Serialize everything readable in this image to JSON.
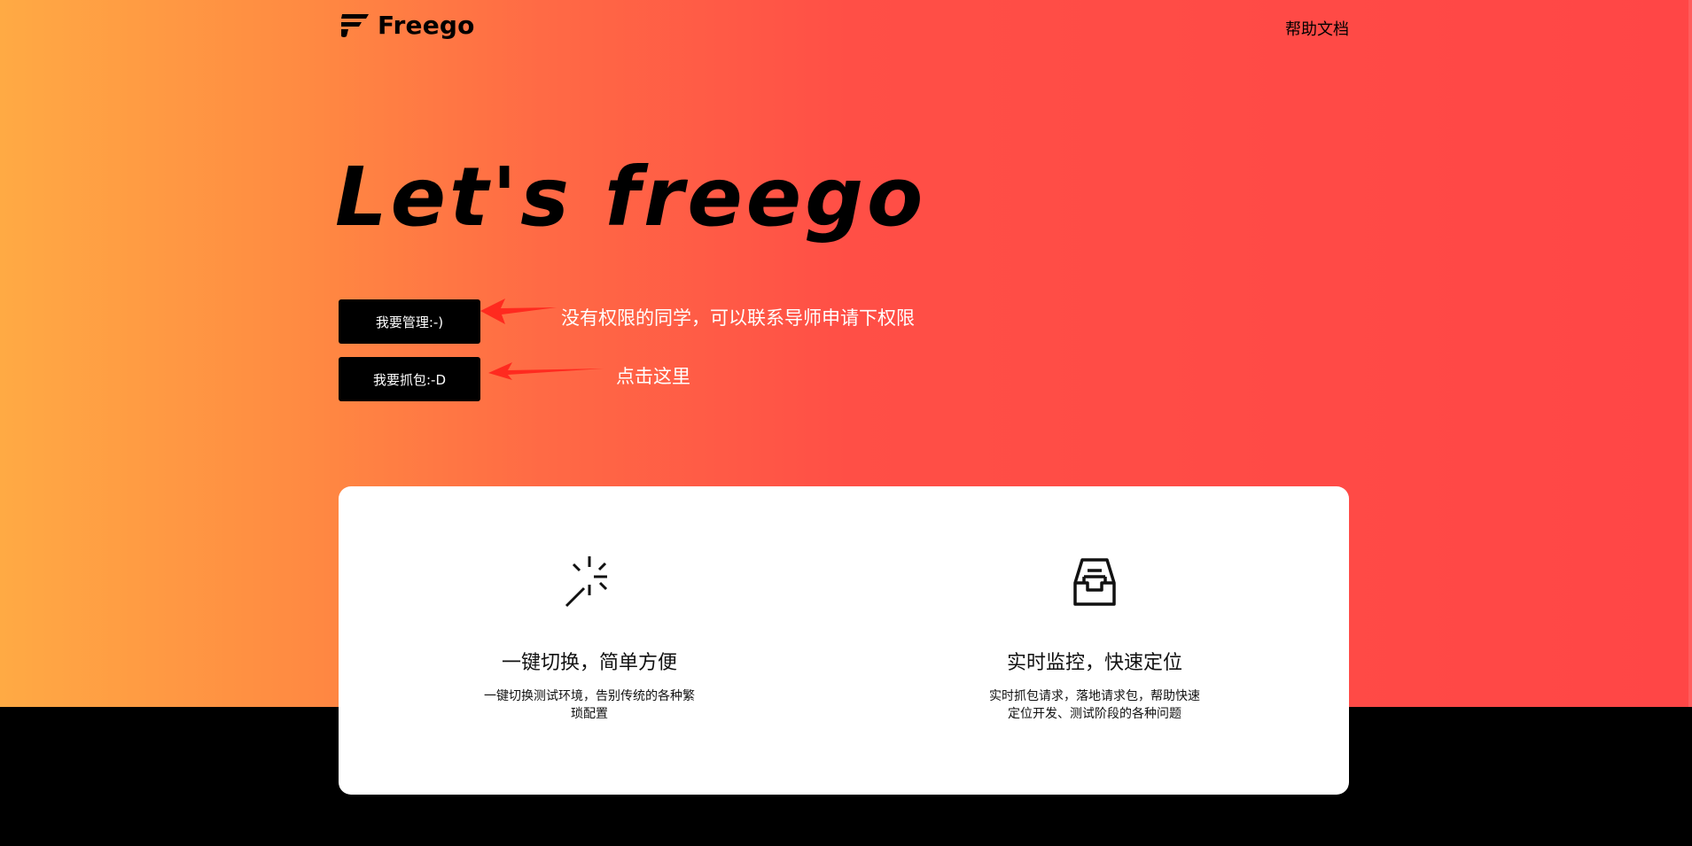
{
  "brand": {
    "name": "Freego"
  },
  "nav": {
    "help": "帮助文档"
  },
  "hero": {
    "headline": "Let's freego",
    "buttons": [
      {
        "label": "我要管理:-)"
      },
      {
        "label": "我要抓包:-D"
      }
    ],
    "annotations": [
      {
        "text": "没有权限的同学，可以联系导师申请下权限"
      },
      {
        "text": "点击这里"
      }
    ]
  },
  "features": [
    {
      "icon": "magic-wand-icon",
      "title": "一键切换，简单方便",
      "desc": "一键切换测试环境，告别传统的各种繁琐配置"
    },
    {
      "icon": "inbox-icon",
      "title": "实时监控，快速定位",
      "desc": "实时抓包请求，落地请求包，帮助快速定位开发、测试阶段的各种问题"
    }
  ],
  "colors": {
    "gradient_start": "#ffaa44",
    "gradient_end": "#ff4646",
    "annotation_arrow": "#ff2a1f",
    "footer": "#000000"
  }
}
